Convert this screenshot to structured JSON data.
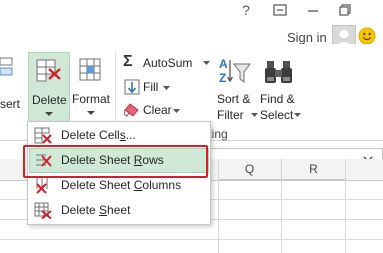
{
  "titlebar": {
    "help_icon": "?",
    "restore_icon": "restore",
    "minimize_icon": "minimize",
    "sign_in": "Sign in",
    "smiley_icon": "smiley"
  },
  "ribbon": {
    "insert_partial": "sert",
    "delete_label": "Delete",
    "format_label": "Format",
    "autosum_label": "AutoSum",
    "fill_label": "Fill",
    "clear_label": "Clear",
    "sort_label_1": "Sort &",
    "sort_label_2": "Filter",
    "find_label_1": "Find &",
    "find_label_2": "Select",
    "group_editing_partial": "diting"
  },
  "columns": [
    "Q",
    "R"
  ],
  "delete_menu": {
    "items": [
      {
        "pre": "Delete Cell",
        "hot": "s",
        "post": "..."
      },
      {
        "pre": "Delete Sheet ",
        "hot": "R",
        "post": "ows"
      },
      {
        "pre": "Delete Sheet ",
        "hot": "C",
        "post": "olumns"
      },
      {
        "pre": "Delete ",
        "hot": "S",
        "post": "heet"
      }
    ]
  },
  "colors": {
    "delete_button_active": "#d0e9d7",
    "menu_highlight": "#d0e9d7",
    "red_outline": "#d1202a",
    "accent_green": "#217346"
  }
}
